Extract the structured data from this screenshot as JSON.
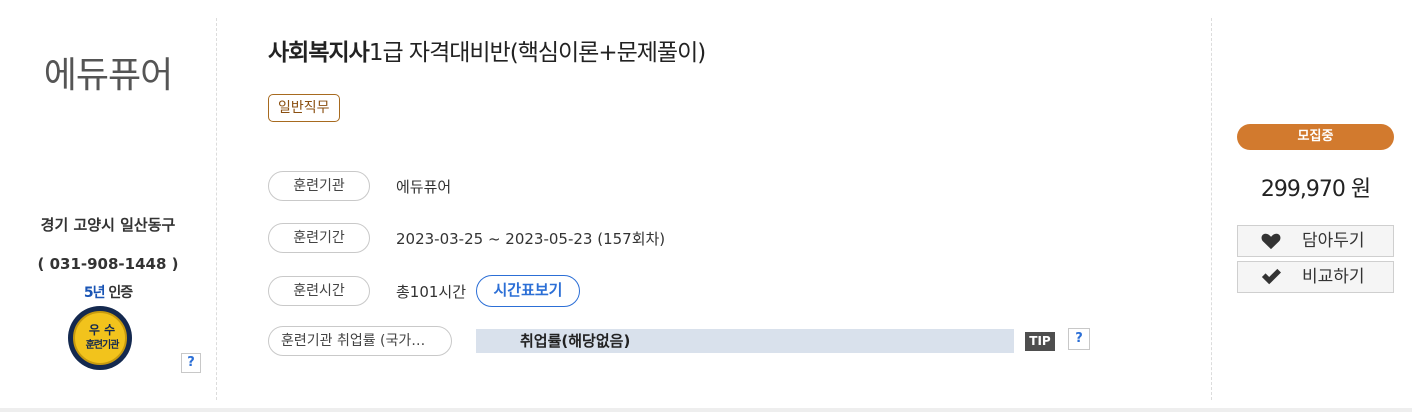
{
  "org": {
    "name": "에듀퓨어",
    "address": "경기 고양시 일산동구",
    "phone": "( 031-908-1448 )",
    "cert_years": "5년",
    "cert_label": "인증",
    "badge_line1": "우 수",
    "badge_line2": "훈련기관",
    "help_label": "?"
  },
  "course": {
    "title_bold": "사회복지사",
    "title_rest": "1급 자격대비반(핵심이론+문제풀이)",
    "category_tag": "일반직무",
    "rows": [
      {
        "label": "훈련기관",
        "value": "에듀퓨어"
      },
      {
        "label": "훈련기간",
        "value": "2023-03-25 ~ 2023-05-23 (157회차)"
      },
      {
        "label": "훈련시간",
        "value": "총101시간"
      }
    ],
    "timetable_button": "시간표보기",
    "employment": {
      "label": "훈련기관 취업률 (국가…",
      "value": "취업률(해당없음)",
      "tip": "TIP",
      "help": "?"
    }
  },
  "side": {
    "status": "모집중",
    "price": "299,970 원",
    "wishlist_button": "담아두기",
    "compare_button": "비교하기"
  },
  "colors": {
    "status_orange": "#d27a2e",
    "link_blue": "#2c6fd6",
    "tag_brown": "#a76a1f",
    "employment_bar": "#d9e1ec"
  }
}
